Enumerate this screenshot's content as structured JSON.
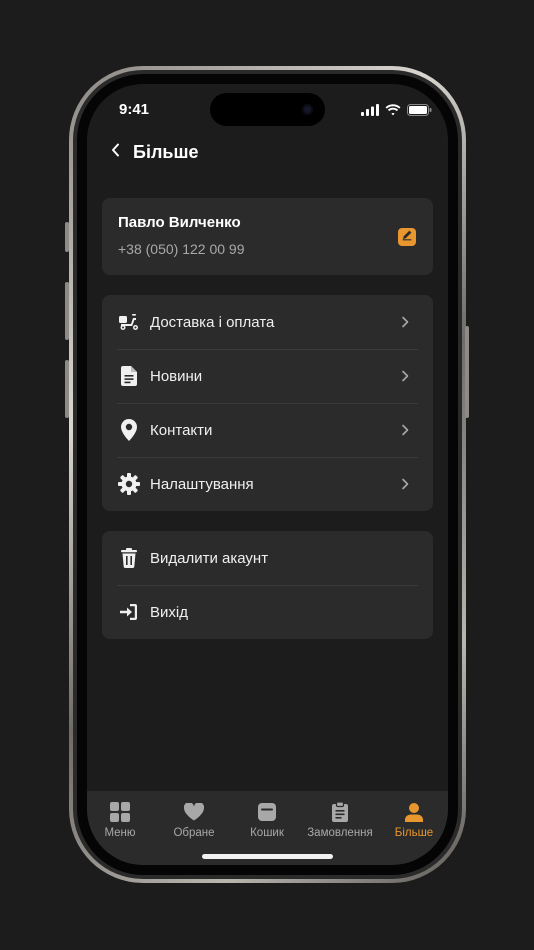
{
  "colors": {
    "accent": "#e8962e",
    "background": "#1c1c1c",
    "card": "#2b2b2b",
    "muted_text": "#a8a8a8"
  },
  "status_bar": {
    "time": "9:41",
    "icons": [
      "signal-icon",
      "wifi-icon",
      "battery-icon"
    ]
  },
  "header": {
    "back_icon": "chevron-left-icon",
    "title": "Більше"
  },
  "profile": {
    "name": "Павло Вилченко",
    "phone": "+38 (050) 122 00 99",
    "edit_icon": "edit-icon"
  },
  "menu": {
    "items": [
      {
        "label": "Доставка і оплата",
        "icon": "delivery-scooter-icon"
      },
      {
        "label": "Новини",
        "icon": "document-icon"
      },
      {
        "label": "Контакти",
        "icon": "location-pin-icon"
      },
      {
        "label": "Налаштування",
        "icon": "gear-icon"
      }
    ]
  },
  "account": {
    "items": [
      {
        "label": "Видалити акаунт",
        "icon": "trash-icon"
      },
      {
        "label": "Вихід",
        "icon": "logout-icon"
      }
    ]
  },
  "tabbar": {
    "active": "Більше",
    "tabs": [
      {
        "label": "Меню",
        "icon": "grid-icon"
      },
      {
        "label": "Обране",
        "icon": "heart-icon"
      },
      {
        "label": "Кошик",
        "icon": "basket-icon"
      },
      {
        "label": "Замовлення",
        "icon": "clipboard-icon"
      },
      {
        "label": "Більше",
        "icon": "user-icon"
      }
    ]
  }
}
